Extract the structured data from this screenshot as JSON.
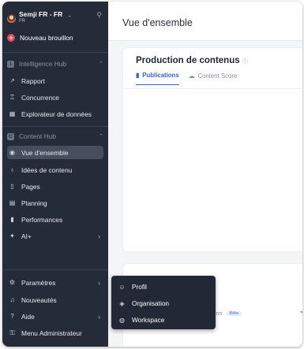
{
  "workspace": {
    "name": "Semji FR - FR",
    "code": "FR",
    "switch_icon": "chevron-updown-icon",
    "pin_icon": "pin-off-icon"
  },
  "new_draft": {
    "label": "Nouveau brouillon"
  },
  "sections": [
    {
      "badge": "I",
      "label": "Intelligence Hub"
    },
    {
      "badge": "C",
      "label": "Content Hub"
    }
  ],
  "intelligence_items": [
    {
      "label": "Rapport",
      "icon": "chart-line-icon"
    },
    {
      "label": "Concurrence",
      "icon": "trophy-icon"
    },
    {
      "label": "Explorateur de données",
      "icon": "table-icon"
    }
  ],
  "content_items": [
    {
      "label": "Vue d'ensemble",
      "icon": "eye-icon",
      "active": true
    },
    {
      "label": "Idées de contenu",
      "icon": "lightbulb-icon"
    },
    {
      "label": "Pages",
      "icon": "file-icon"
    },
    {
      "label": "Planning",
      "icon": "calendar-icon"
    },
    {
      "label": "Performances",
      "icon": "bar-chart-icon"
    },
    {
      "label": "AI+",
      "icon": "sparkles-icon"
    }
  ],
  "bottom_items": [
    {
      "label": "Paramètres",
      "icon": "gear-icon"
    },
    {
      "label": "Nouveautés",
      "icon": "bell-icon"
    },
    {
      "label": "Aide",
      "icon": "help-icon"
    },
    {
      "label": "Menu Administrateur",
      "icon": "admin-icon"
    }
  ],
  "main": {
    "title": "Vue d'ensemble",
    "card_title": "Production de contenus",
    "tabs": [
      {
        "label": "Publications",
        "active": true
      },
      {
        "label": "Content Score",
        "active": false
      }
    ],
    "card2_title_fragment": "u",
    "card2_tab_fragment": "ositions",
    "beta": "Bêta"
  },
  "flyout": [
    {
      "label": "Profil",
      "icon": "user-icon"
    },
    {
      "label": "Organisation",
      "icon": "layers-icon"
    },
    {
      "label": "Workspace",
      "icon": "globe-icon"
    }
  ],
  "colors": {
    "sidebar": "#262b3a",
    "accent": "#3b62c9",
    "new_draft": "#e24a5a"
  }
}
